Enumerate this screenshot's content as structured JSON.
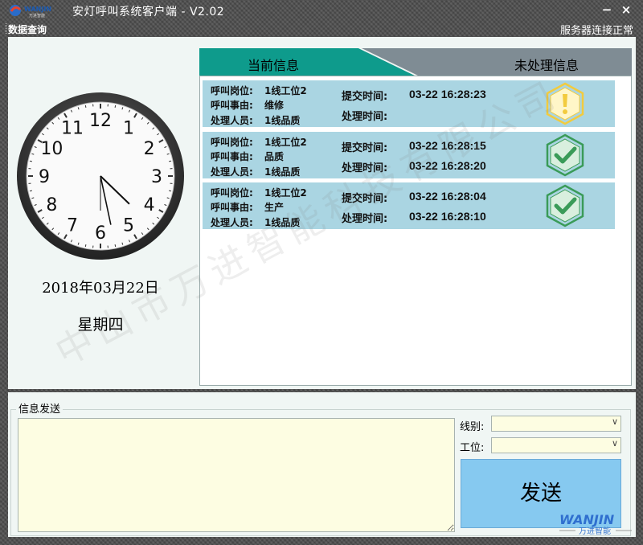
{
  "window": {
    "title": "安灯呼叫系统客户端 - V2.02",
    "minimize": "−",
    "close": "×"
  },
  "menu": {
    "query": "数据查询",
    "status": "服务器连接正常"
  },
  "clock": {
    "numerals": [
      "12",
      "1",
      "2",
      "3",
      "4",
      "5",
      "6",
      "7",
      "8",
      "9",
      "10",
      "11"
    ],
    "time": "16:28"
  },
  "date": "2018年03月22日",
  "weekday": "星期四",
  "tabs": {
    "current": "当前信息",
    "pending": "未处理信息"
  },
  "field_labels": {
    "post": "呼叫岗位:",
    "reason": "呼叫事由:",
    "handler": "处理人员:",
    "submit": "提交时间:",
    "process": "处理时间:"
  },
  "calls": [
    {
      "post": "1线工位2",
      "reason": "维修",
      "handler": "1线品质",
      "submit": "03-22 16:28:23",
      "process": "",
      "state": "warning-icon"
    },
    {
      "post": "1线工位2",
      "reason": "品质",
      "handler": "1线品质",
      "submit": "03-22 16:28:15",
      "process": "03-22 16:28:20",
      "state": "check-icon"
    },
    {
      "post": "1线工位2",
      "reason": "生产",
      "handler": "1线品质",
      "submit": "03-22 16:28:04",
      "process": "03-22 16:28:10",
      "state": "check-icon"
    }
  ],
  "send": {
    "group_title": "信息发送",
    "line_label": "线别:",
    "station_label": "工位:",
    "line_value": "",
    "station_value": "",
    "button": "发送"
  },
  "watermark": "中山市万进智能科技有限公司",
  "brand": {
    "logo_text": "WANJIN",
    "tagline": "万进智能"
  },
  "colors": {
    "tab_active": "#0e9b8c",
    "tab_inactive": "#7f8c94",
    "row_bg": "#aad5e2",
    "warning": "#f2cb3e",
    "ok": "#3a9b58",
    "send_button": "#86c9f0"
  }
}
